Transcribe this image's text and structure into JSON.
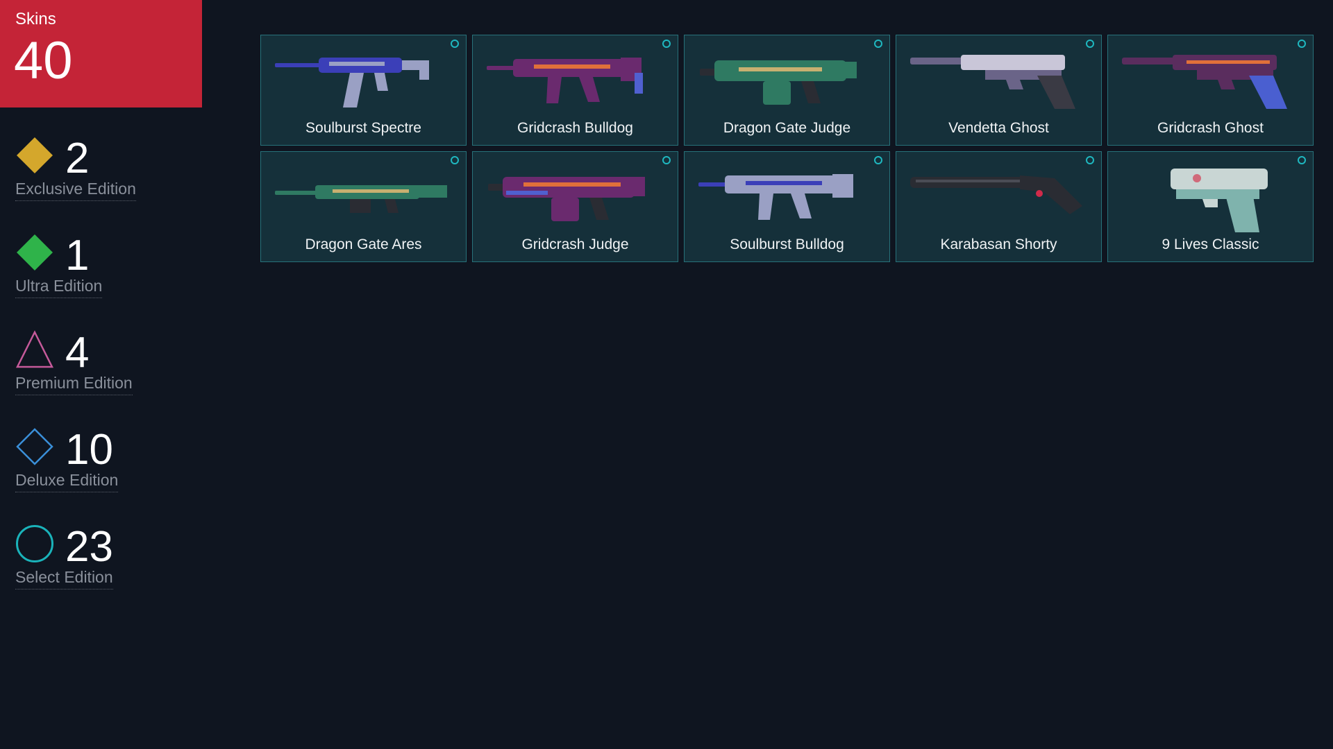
{
  "total": {
    "label": "Skins",
    "value": "40",
    "color": "#c42437"
  },
  "tiers": [
    {
      "count": "2",
      "name": "Exclusive Edition",
      "icon": "diamond-filled-gold-icon",
      "color": "#d4a72c"
    },
    {
      "count": "1",
      "name": "Ultra Edition",
      "icon": "diamond-filled-green-icon",
      "color": "#2fb34a"
    },
    {
      "count": "4",
      "name": "Premium Edition",
      "icon": "triangle-outline-pink-icon",
      "color": "#c55a9a"
    },
    {
      "count": "10",
      "name": "Deluxe Edition",
      "icon": "diamond-outline-blue-icon",
      "color": "#3a8fd9"
    },
    {
      "count": "23",
      "name": "Select Edition",
      "icon": "circle-outline-teal-icon",
      "color": "#1ab3ba"
    }
  ],
  "skins": [
    {
      "name": "Soulburst Spectre",
      "icon": "smg-icon",
      "tier_icon": "circle-outline-teal-icon",
      "colors": [
        "#3b3fb8",
        "#9aa0c4"
      ]
    },
    {
      "name": "Gridcrash Bulldog",
      "icon": "rifle-icon",
      "tier_icon": "circle-outline-teal-icon",
      "colors": [
        "#6a2a6e",
        "#e0703a"
      ]
    },
    {
      "name": "Dragon Gate Judge",
      "icon": "shotgun-icon",
      "tier_icon": "circle-outline-teal-icon",
      "colors": [
        "#2f7a62",
        "#c8b070"
      ]
    },
    {
      "name": "Vendetta Ghost",
      "icon": "pistol-icon",
      "tier_icon": "circle-outline-teal-icon",
      "colors": [
        "#6a6488",
        "#c9c6d8"
      ]
    },
    {
      "name": "Gridcrash Ghost",
      "icon": "pistol-icon",
      "tier_icon": "circle-outline-teal-icon",
      "colors": [
        "#5a2d5e",
        "#e0703a"
      ]
    },
    {
      "name": "Dragon Gate Ares",
      "icon": "machinegun-icon",
      "tier_icon": "circle-outline-teal-icon",
      "colors": [
        "#2f7a62",
        "#c8b070"
      ]
    },
    {
      "name": "Gridcrash Judge",
      "icon": "shotgun-icon",
      "tier_icon": "circle-outline-teal-icon",
      "colors": [
        "#6a2a6e",
        "#e0703a"
      ]
    },
    {
      "name": "Soulburst Bulldog",
      "icon": "rifle-icon",
      "tier_icon": "circle-outline-teal-icon",
      "colors": [
        "#3b3fb8",
        "#9aa0c4"
      ]
    },
    {
      "name": "Karabasan Shorty",
      "icon": "sawed-shotgun-icon",
      "tier_icon": "circle-outline-teal-icon",
      "colors": [
        "#2a2c33",
        "#d02a4a"
      ]
    },
    {
      "name": "9 Lives Classic",
      "icon": "pistol-icon",
      "tier_icon": "circle-outline-teal-icon",
      "colors": [
        "#7fb3ad",
        "#c9d6d4"
      ]
    }
  ]
}
